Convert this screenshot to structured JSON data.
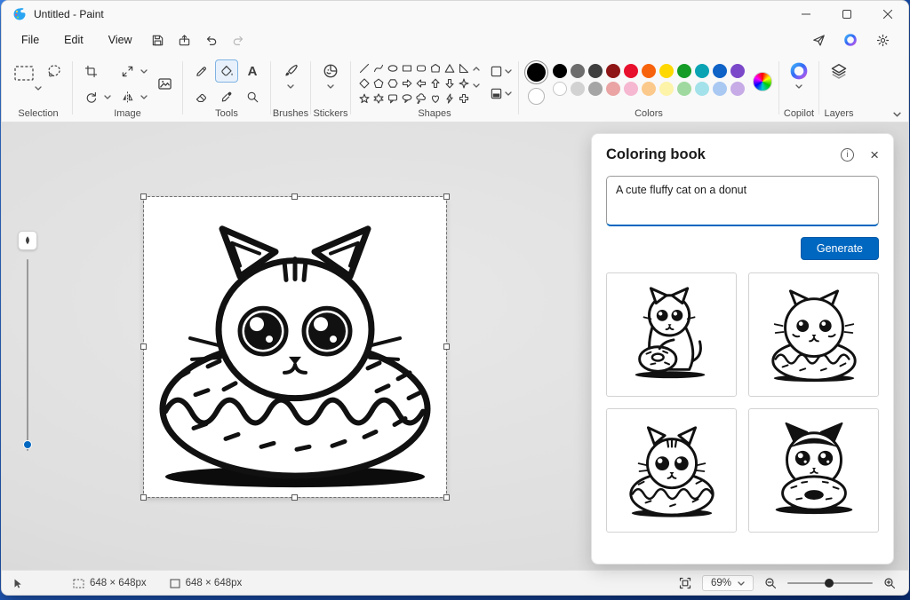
{
  "window": {
    "title": "Untitled - Paint"
  },
  "menubar": {
    "items": [
      "File",
      "Edit",
      "View"
    ]
  },
  "ribbon": {
    "groups": {
      "selection": "Selection",
      "image": "Image",
      "tools": "Tools",
      "brushes": "Brushes",
      "stickers": "Stickers",
      "shapes": "Shapes",
      "colors": "Colors",
      "copilot": "Copilot",
      "layers": "Layers"
    },
    "text_tool_label": "A",
    "shape_icons": [
      "line",
      "curve",
      "oval",
      "rectangle",
      "rounded-rectangle",
      "polygon",
      "triangle",
      "right-triangle",
      "diamond",
      "pentagon",
      "hexagon",
      "arrow-right",
      "arrow-left",
      "arrow-up",
      "arrow-down",
      "star-four",
      "star-five",
      "star-six",
      "callout-rounded",
      "callout-oval",
      "callout-cloud",
      "heart",
      "lightning",
      "cross"
    ]
  },
  "colors": {
    "foreground": "#000000",
    "background": "#ffffff",
    "accent": "#0067c0",
    "palette": [
      [
        "#000000",
        "#6d6d6d",
        "#3f3f3f",
        "#8f1616",
        "#e8112d",
        "#f7630c",
        "#ffd800",
        "#159c27",
        "#0aa3b4",
        "#0f62c6",
        "#7b48c9"
      ],
      [
        "#ffffff",
        "#d2d2d2",
        "#a5a5a5",
        "#eaa4a4",
        "#f5b8d0",
        "#fbc98c",
        "#fdf3a9",
        "#9fd99f",
        "#a3e2ea",
        "#a9c8f2",
        "#c6abe6"
      ]
    ]
  },
  "panel": {
    "title": "Coloring book",
    "prompt": "A cute fluffy cat on a donut",
    "generate_label": "Generate",
    "thumbnails": [
      "cat-hugging-donut",
      "fluffy-cat-on-donut",
      "cat-in-donut",
      "tuxedo-cat-behind-donut"
    ]
  },
  "status": {
    "selection_size": "648 × 648px",
    "canvas_size": "648 × 648px",
    "zoom": "69%"
  },
  "glyphs": {
    "close": "×",
    "info": "i"
  }
}
